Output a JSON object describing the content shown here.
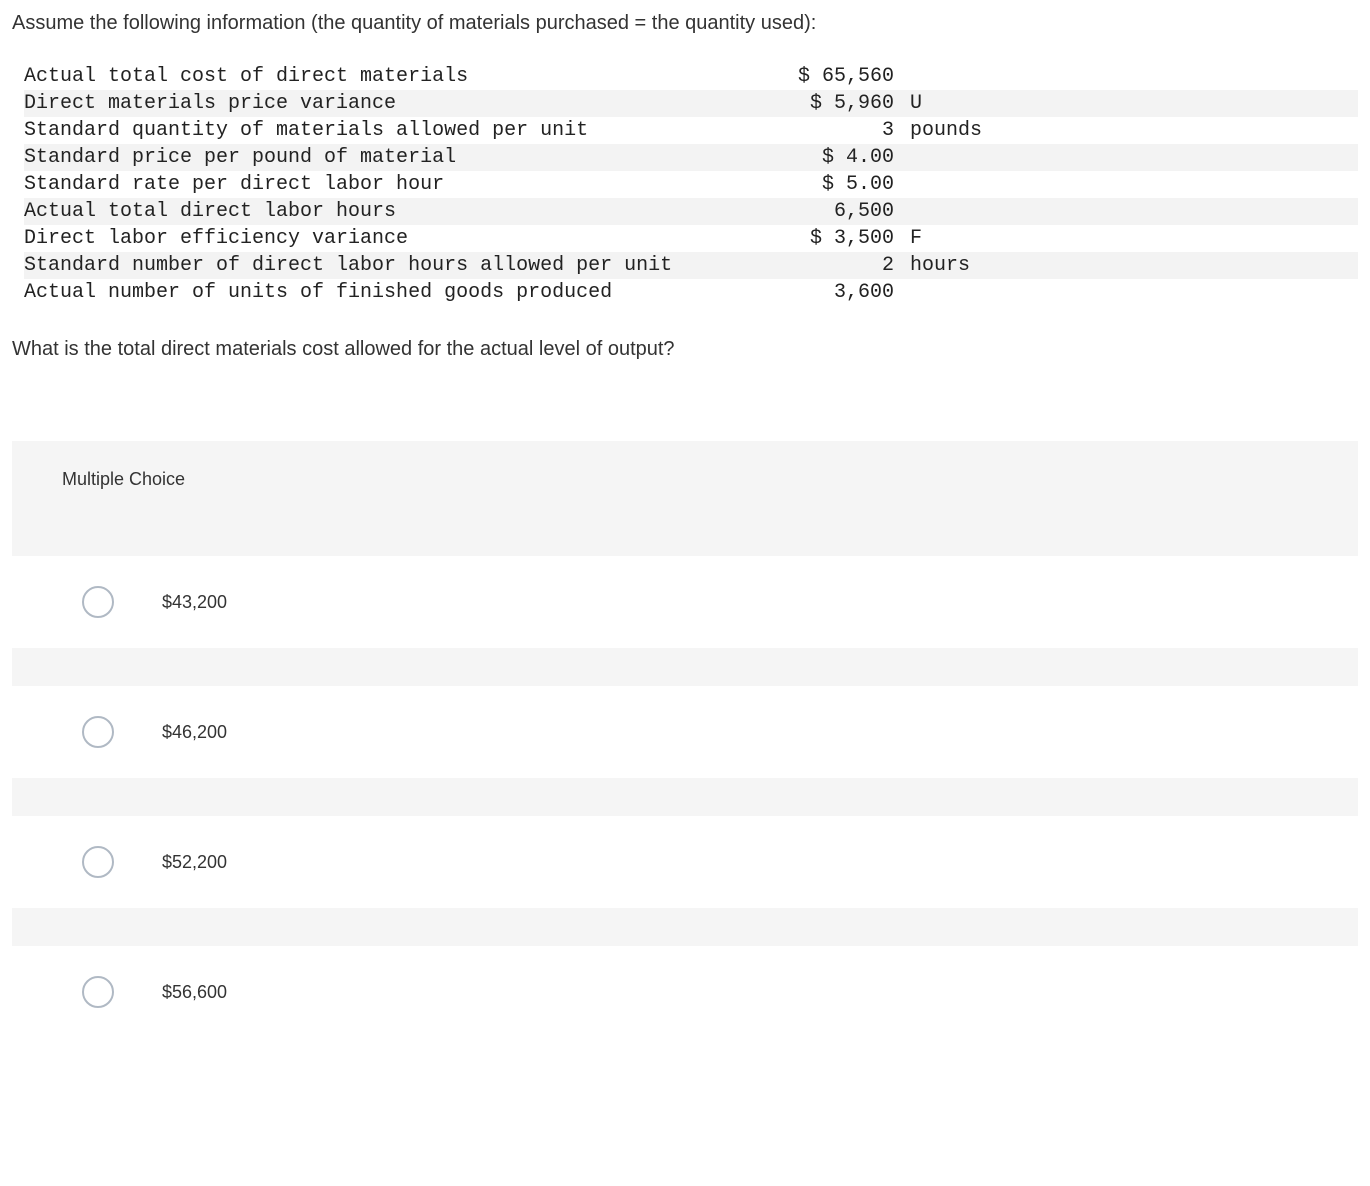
{
  "intro": "Assume the following information (the quantity of materials purchased = the quantity used):",
  "rows": [
    {
      "label": "Actual total cost of direct materials",
      "value": "$ 65,560",
      "suffix": ""
    },
    {
      "label": "Direct materials price variance",
      "value": "$ 5,960",
      "suffix": " U"
    },
    {
      "label": "Standard quantity of materials allowed per unit",
      "value": "3",
      "suffix": " pounds"
    },
    {
      "label": "Standard price per pound of material",
      "value": "$ 4.00",
      "suffix": ""
    },
    {
      "label": "Standard rate per direct labor hour",
      "value": "$ 5.00",
      "suffix": ""
    },
    {
      "label": "Actual total direct labor hours",
      "value": "6,500",
      "suffix": ""
    },
    {
      "label": "Direct labor efficiency variance",
      "value": "$ 3,500",
      "suffix": " F"
    },
    {
      "label": "Standard number of direct labor hours allowed per unit",
      "value": "2",
      "suffix": " hours"
    },
    {
      "label": "Actual number of units of finished goods produced",
      "value": "3,600",
      "suffix": ""
    }
  ],
  "question": "What is the total direct materials cost allowed for the actual level of output?",
  "mc_header": "Multiple Choice",
  "options": [
    "$43,200",
    "$46,200",
    "$52,200",
    "$56,600"
  ]
}
